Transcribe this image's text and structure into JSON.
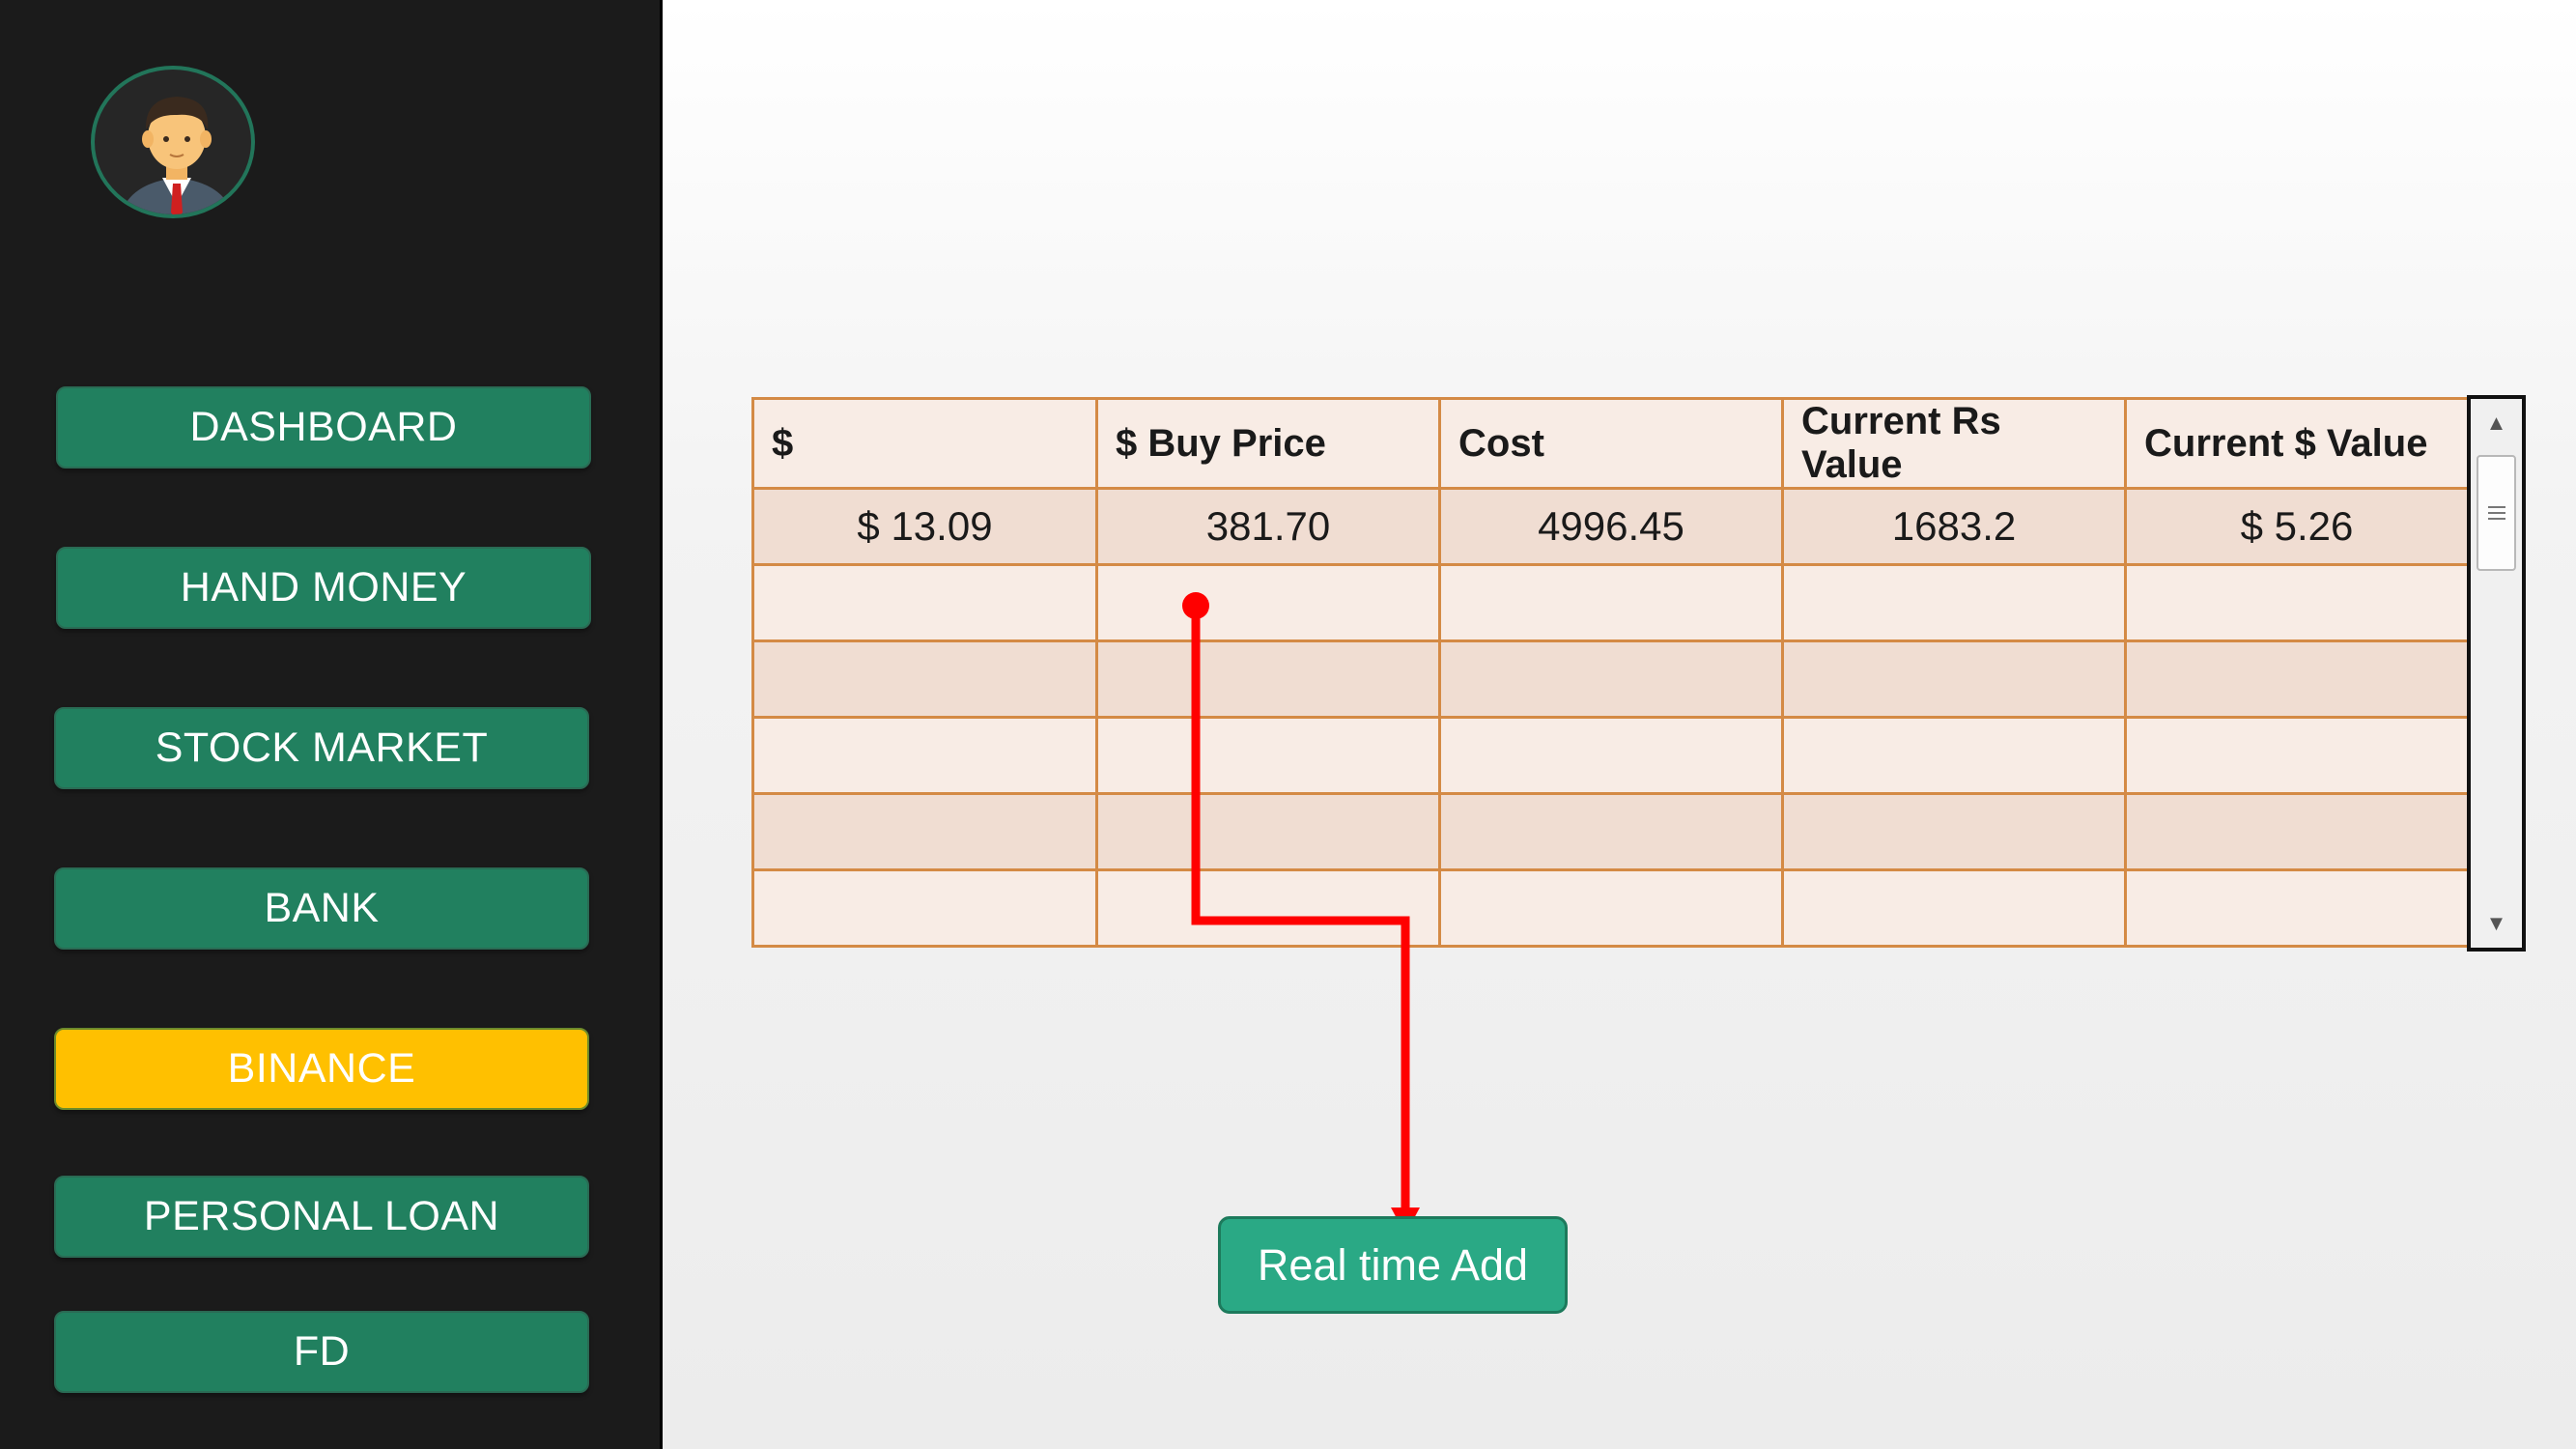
{
  "sidebar": {
    "avatar": "user-avatar",
    "items": [
      {
        "label": "DASHBOARD",
        "active": false
      },
      {
        "label": "HAND MONEY",
        "active": false
      },
      {
        "label": "STOCK MARKET",
        "active": false
      },
      {
        "label": "BANK",
        "active": false
      },
      {
        "label": "BINANCE",
        "active": true
      },
      {
        "label": "PERSONAL LOAN",
        "active": false
      },
      {
        "label": "FD",
        "active": false
      }
    ]
  },
  "table": {
    "headers": [
      "$",
      "$ Buy Price",
      "Cost",
      "Current Rs Value",
      "Current $ Value"
    ],
    "rows": [
      [
        "$ 13.09",
        "381.70",
        "4996.45",
        "1683.2",
        "$ 5.26"
      ],
      [
        "",
        "",
        "",
        "",
        ""
      ],
      [
        "",
        "",
        "",
        "",
        ""
      ],
      [
        "",
        "",
        "",
        "",
        ""
      ],
      [
        "",
        "",
        "",
        "",
        ""
      ],
      [
        "",
        "",
        "",
        "",
        ""
      ]
    ]
  },
  "action": {
    "realtime_label": "Real time Add"
  },
  "colors": {
    "sidebar_bg": "#1b1b1b",
    "button_green": "#21805f",
    "active_yellow": "#ffc000",
    "table_border": "#d48a45",
    "connector_red": "#ff0000"
  }
}
